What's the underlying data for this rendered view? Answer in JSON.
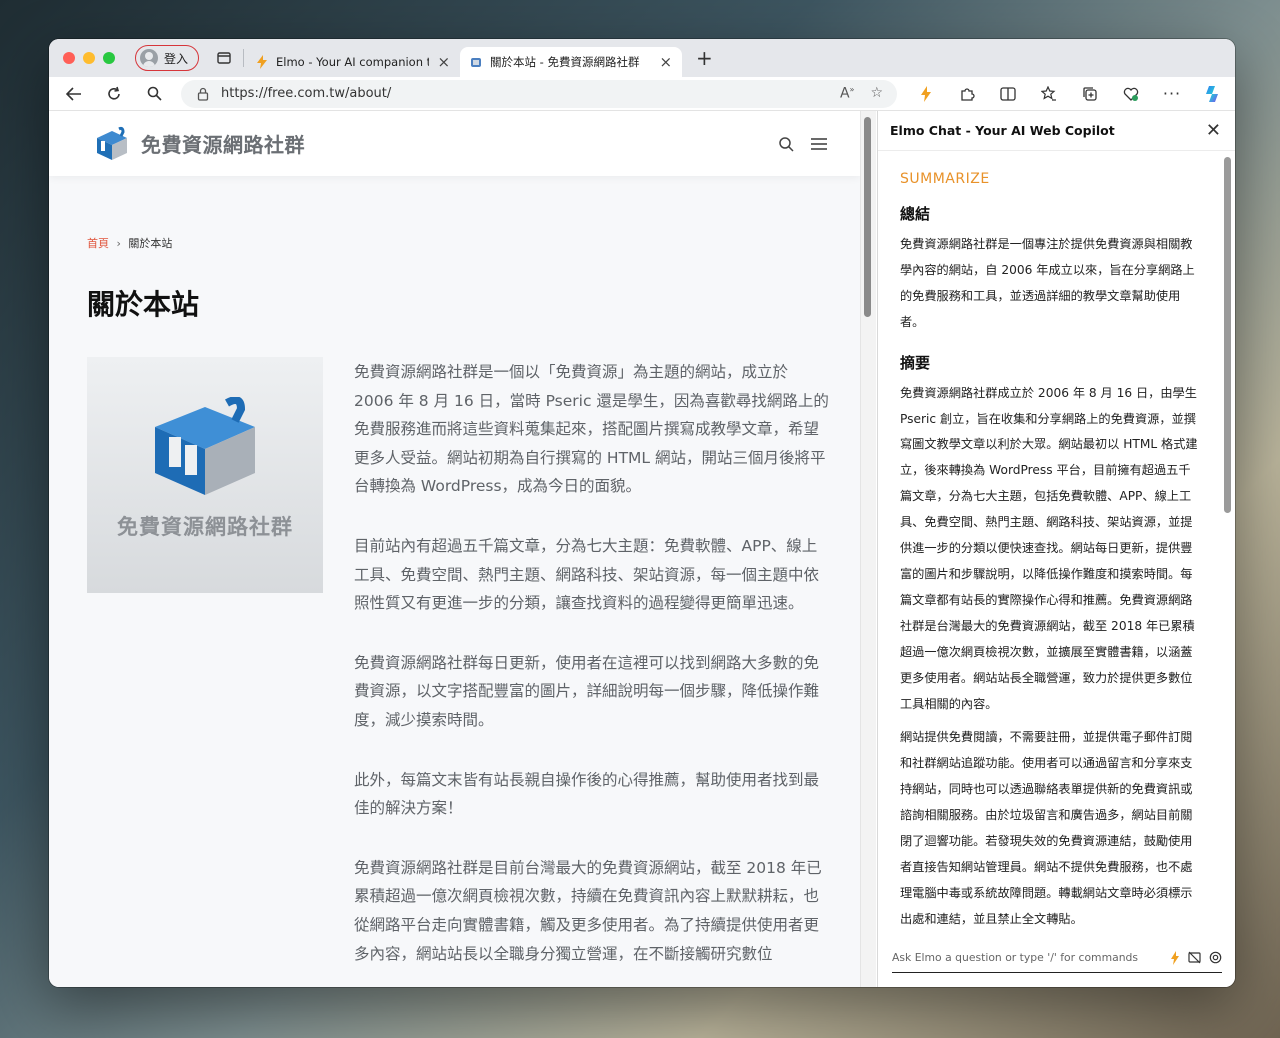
{
  "browser": {
    "profile_label": "登入",
    "tabs": [
      {
        "title": "Elmo - Your AI companion to c",
        "icon": "lightning-icon"
      },
      {
        "title": "關於本站 - 免費資源網路社群",
        "icon": "site-favicon"
      }
    ],
    "address": "https://free.com.tw/about/"
  },
  "site": {
    "logo_text": "免費資源網路社群",
    "breadcrumb": {
      "home": "首頁",
      "separator": "›",
      "current": "關於本站"
    },
    "title": "關於本站",
    "featured_caption": "免費資源網路社群",
    "paragraphs": [
      "免費資源網路社群是一個以「免費資源」為主題的網站，成立於 2006 年 8 月 16 日，當時 Pseric 還是學生，因為喜歡尋找網路上的免費服務進而將這些資料蒐集起來，搭配圖片撰寫成教學文章，希望更多人受益。網站初期為自行撰寫的 HTML 網站，開站三個月後將平台轉換為 WordPress，成為今日的面貌。",
      "目前站內有超過五千篇文章，分為七大主題：免費軟體、APP、線上工具、免費空間、熱門主題、網路科技、架站資源，每一個主題中依照性質又有更進一步的分類，讓查找資料的過程變得更簡單迅速。",
      "免費資源網路社群每日更新，使用者在這裡可以找到網路大多數的免費資源，以文字搭配豐富的圖片，詳細說明每一個步驟，降低操作難度，減少摸索時間。",
      "此外，每篇文末皆有站長親自操作後的心得推薦，幫助使用者找到最佳的解決方案！",
      "免費資源網路社群是目前台灣最大的免費資源網站，截至 2018 年已累積超過一億次網頁檢視次數，持續在免費資訊內容上默默耕耘，也從網路平台走向實體書籍，觸及更多使用者。為了持續提供使用者更多內容，網站站長以全職身分獨立營運，在不斷接觸研究數位"
    ]
  },
  "panel": {
    "title": "Elmo Chat - Your AI Web Copilot",
    "section_label": "SUMMARIZE",
    "summary_heading": "總結",
    "summary_text": "免費資源網路社群是一個專注於提供免費資源與相關教學內容的網站，自 2006 年成立以來，旨在分享網路上的免費服務和工具，並透過詳細的教學文章幫助使用者。",
    "abstract_heading": "摘要",
    "abstract_text_1": "免費資源網路社群成立於 2006 年 8 月 16 日，由學生 Pseric 創立，旨在收集和分享網路上的免費資源，並撰寫圖文教學文章以利於大眾。網站最初以 HTML 格式建立，後來轉換為 WordPress 平台，目前擁有超過五千篇文章，分為七大主題，包括免費軟體、APP、線上工具、免費空間、熱門主題、網路科技、架站資源，並提供進一步的分類以便快速查找。網站每日更新，提供豐富的圖片和步驟說明，以降低操作難度和摸索時間。每篇文章都有站長的實際操作心得和推薦。免費資源網路社群是台灣最大的免費資源網站，截至 2018 年已累積超過一億次網頁檢視次數，並擴展至實體書籍，以涵蓋更多使用者。網站站長全職營運，致力於提供更多數位工具相關的內容。",
    "abstract_text_2": "網站提供免費閱讀，不需要註冊，並提供電子郵件訂閱和社群網站追蹤功能。使用者可以通過留言和分享來支持網站，同時也可以透過聯絡表單提供新的免費資訊或諮詢相關服務。由於垃圾留言和廣告過多，網站目前關閉了迴響功能。若發現失效的免費資源連結，鼓勵使用者直接告知網站管理員。網站不提供免費服務，也不處理電腦中毒或系統故障問題。轉載網站文章時必須標示出處和連結，並且禁止全文轉貼。",
    "input_placeholder": "Ask Elmo a question or type '/' for commands"
  },
  "colors": {
    "accent_orange": "#e8922a",
    "breadcrumb_home": "#e0553c",
    "logo_blue": "#1f6fb6"
  }
}
